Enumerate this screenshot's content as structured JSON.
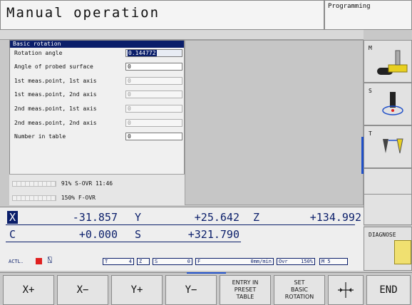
{
  "header": {
    "title": "Manual operation",
    "mode": "Programming"
  },
  "dialog": {
    "title": "Basic rotation",
    "rows": [
      {
        "label": "Rotation angle",
        "value": "0.144772"
      },
      {
        "label": "Angle of probed surface",
        "value": "0"
      },
      {
        "label": "1st meas.point, 1st axis",
        "value": "0"
      },
      {
        "label": "1st meas.point, 2nd axis",
        "value": "0"
      },
      {
        "label": "2nd meas.point, 1st axis",
        "value": "0"
      },
      {
        "label": "2nd meas.point, 2nd axis",
        "value": "0"
      },
      {
        "label": "Number in table",
        "value": "0"
      }
    ]
  },
  "overrides": {
    "s": "91% S-OVR 11:46",
    "f": "150% F-OVR"
  },
  "positions": [
    {
      "axis": "X",
      "value": "-31.857"
    },
    {
      "axis": "Y",
      "value": "+25.642"
    },
    {
      "axis": "Z",
      "value": "+134.992"
    },
    {
      "axis": "C",
      "value": "+0.000"
    },
    {
      "axis": "S",
      "value": "+321.790"
    }
  ],
  "status": {
    "mode": "ACTL.",
    "t_label": "T",
    "t_value": "4",
    "z_label": "Z",
    "s_label": "S",
    "s_value": "0",
    "f_label": "F",
    "f_value": "0mm/min",
    "ovr_label": "Ovr",
    "ovr_value": "150%",
    "m_value": "M 5"
  },
  "right_softkeys": {
    "m": "M",
    "s": "S",
    "t": "T",
    "diagnose": "DIAGNOSE"
  },
  "bottom_softkeys": {
    "xplus": "X+",
    "xminus": "X−",
    "yplus": "Y+",
    "yminus": "Y−",
    "entry": "ENTRY IN\nPRESET\nTABLE",
    "setrot": "SET\nBASIC\nROTATION",
    "end": "END"
  },
  "colors": {
    "accent": "#0a1e6a",
    "highlight": "#2050c8",
    "warning": "#e02020",
    "tool": "#e8d020"
  }
}
